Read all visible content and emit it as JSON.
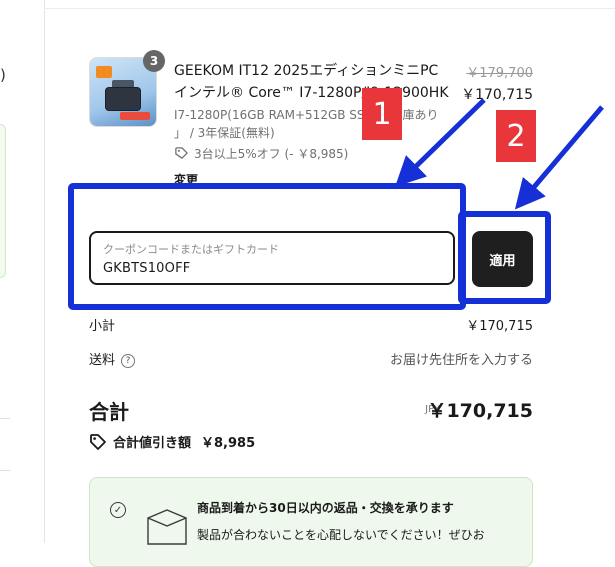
{
  "product": {
    "quantity_badge": "3",
    "name_line1": "GEEKOM IT12 2025エディションミニPC",
    "name_line2": "インテル® Core™ I7-1280P/I9-12900HK",
    "variant_line1": "I7-1280P(16GB RAM+512GB SSD)「在庫あり",
    "variant_line2": "」 / 3年保証(無料)",
    "discount_text": "3台以上5%オフ (- ￥8,985)",
    "change_link": "変更",
    "price_original": "￥179,700",
    "price_current": "￥170,715"
  },
  "coupon": {
    "placeholder": "クーポンコードまたはギフトカード",
    "value": "GKBTS10OFF",
    "apply_label": "適用"
  },
  "summary": {
    "subtotal_label": "小計",
    "subtotal_value": "￥170,715",
    "shipping_label": "送料",
    "shipping_help_glyph": "?",
    "shipping_value": "お届け先住所を入力する",
    "total_label": "合計",
    "currency": "JPY",
    "total_value": "￥170,715",
    "savings_label": "合計値引き額",
    "savings_value": "￥8,985"
  },
  "return_policy": {
    "title": "商品到着から30日以内の返品・交換を承ります",
    "body": "製品が合わないことを心配しないでください！ぜひお"
  },
  "annotations": {
    "marker1": "1",
    "marker2": "2",
    "highlight_color": "#1530d6",
    "marker_color": "#e8363b"
  },
  "colors": {
    "apply_button": "#1f1f1f",
    "return_card_bg": "#eef8ec"
  },
  "icons": [
    "tag-icon",
    "help-circle-icon",
    "savings-tag-icon",
    "check-circle-icon",
    "box-icon"
  ]
}
